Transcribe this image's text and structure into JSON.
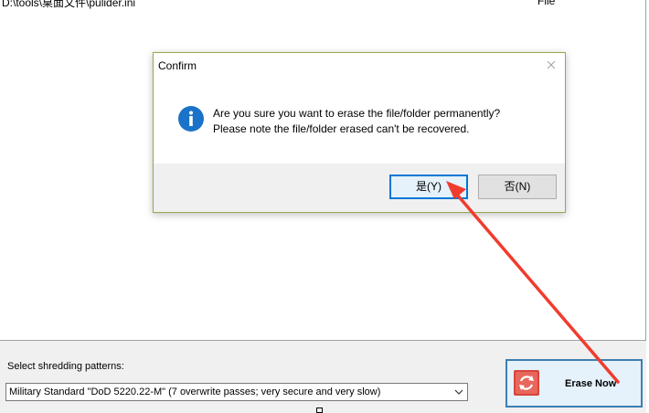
{
  "file_list": {
    "rows": [
      {
        "path": "D:\\tools\\桌面文件\\pulider.ini",
        "type": "File"
      }
    ]
  },
  "shredding": {
    "label": "Select shredding patterns:",
    "selected": "Military Standard \"DoD 5220.22-M\" (7 overwrite passes; very secure and very slow)"
  },
  "erase_button": {
    "label": "Erase Now"
  },
  "dialog": {
    "title": "Confirm",
    "message_line1": "Are you sure you want to erase the file/folder permanently?",
    "message_line2": "Please note the file/folder erased can't be recovered.",
    "yes_label": "是(Y)",
    "no_label": "否(N)"
  },
  "colors": {
    "dialog_border": "#9aa64a",
    "info_blue": "#1a73c8",
    "focus_blue": "#0078d7",
    "annotation_red": "#f03c2e",
    "erase_icon_red": "#d9443b"
  },
  "icons": [
    "info-icon",
    "close-icon",
    "chevron-down-icon",
    "shred-icon",
    "annotation-arrow"
  ]
}
